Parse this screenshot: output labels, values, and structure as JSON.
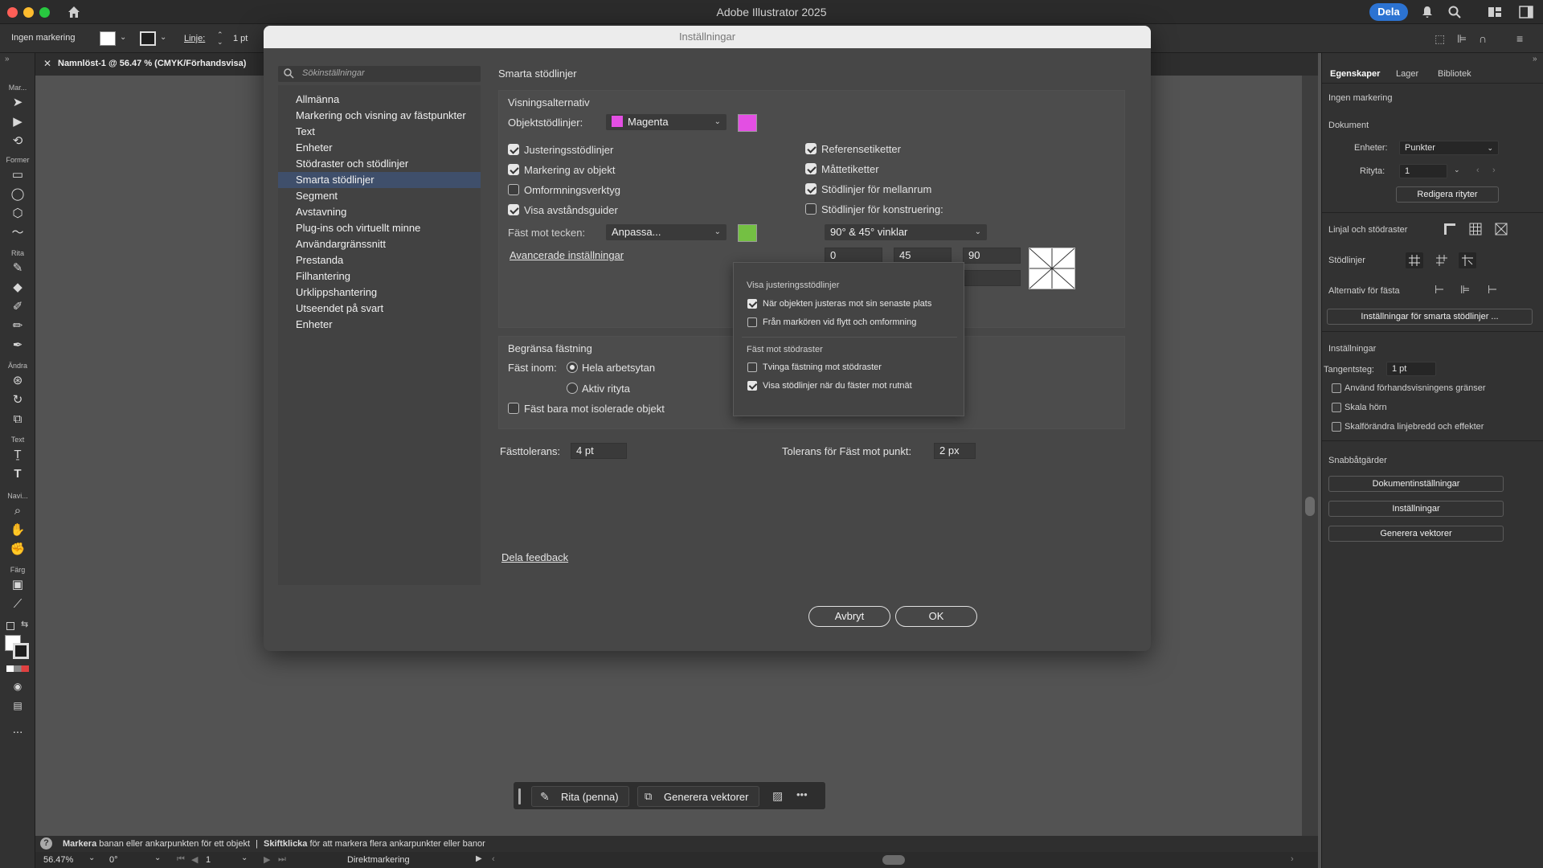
{
  "app": {
    "title": "Adobe Illustrator 2025",
    "share": "Dela",
    "accent": "#2c73d2"
  },
  "controlbar": {
    "selection": "Ingen markering",
    "stroke_label": "Linje:",
    "stroke_value": "1 pt"
  },
  "document_tab": {
    "name": "Namnlöst-1 @ 56.47 % (CMYK/Förhandsvisa)"
  },
  "tools": {
    "categories": [
      "Mar...",
      "Former",
      "Rita",
      "Ändra",
      "Text",
      "Navi...",
      "Färg"
    ],
    "more": "..."
  },
  "properties_panel": {
    "tabs": [
      "Egenskaper",
      "Lager",
      "Bibliotek"
    ],
    "no_selection": "Ingen markering",
    "document_label": "Dokument",
    "units_label": "Enheter:",
    "units_value": "Punkter",
    "artboard_label": "Rityta:",
    "artboard_value": "1",
    "edit_artboards": "Redigera rityter",
    "rulers_label": "Linjal och stödraster",
    "guides_label": "Stödlinjer",
    "snap_label": "Alternativ för fästa",
    "smart_guides_btn": "Inställningar för smarta stödlinjer ...",
    "preferences_label": "Inställningar",
    "keyboard_inc_label": "Tangentsteg:",
    "keyboard_inc_value": "1 pt",
    "pref_checks": [
      {
        "label": "Använd förhandsvisningens gränser",
        "checked": false
      },
      {
        "label": "Skala hörn",
        "checked": false
      },
      {
        "label": "Skalförändra linjebredd och effekter",
        "checked": false
      }
    ],
    "quick_actions_label": "Snabbåtgärder",
    "quick_actions": [
      "Dokumentinställningar",
      "Inställningar",
      "Generera vektorer"
    ]
  },
  "dialog": {
    "title": "Inställningar",
    "search_placeholder": "Sökinställningar",
    "nav": [
      "Allmänna",
      "Markering och visning av fästpunkter",
      "Text",
      "Enheter",
      "Stödraster och stödlinjer",
      "Smarta stödlinjer",
      "Segment",
      "Avstavning",
      "Plug-ins och virtuellt minne",
      "Användargränssnitt",
      "Prestanda",
      "Filhantering",
      "Urklippshantering",
      "Utseendet på svart",
      "Enheter"
    ],
    "selected_nav": "Smarta stödlinjer",
    "page_title": "Smarta stödlinjer",
    "display_options": {
      "title": "Visningsalternativ",
      "object_guides_label": "Objektstödlinjer:",
      "object_guides_value": "Magenta",
      "object_guides_color": "#e34fe3",
      "left_checks": [
        {
          "label": "Justeringsstödlinjer",
          "checked": true
        },
        {
          "label": "Markering av objekt",
          "checked": true
        },
        {
          "label": "Omformningsverktyg",
          "checked": false
        },
        {
          "label": "Visa avståndsguider",
          "checked": true
        }
      ],
      "right_checks": [
        {
          "label": "Referensetiketter",
          "checked": true
        },
        {
          "label": "Måttetiketter",
          "checked": true
        },
        {
          "label": "Stödlinjer för mellanrum",
          "checked": true
        },
        {
          "label": "Stödlinjer för konstruering:",
          "checked": false
        }
      ],
      "snap_to_glyph_label": "Fäst mot tecken:",
      "snap_to_glyph_value": "Anpassa...",
      "snap_to_glyph_color": "#74c043",
      "construction_angles": "90° & 45° vinklar",
      "angles": [
        "0",
        "45",
        "90"
      ],
      "advanced_link": "Avancerade inställningar"
    },
    "advanced_popup": {
      "section1": "Visa justeringsstödlinjer",
      "checks1": [
        {
          "label": "När objekten justeras mot sin senaste plats",
          "checked": true
        },
        {
          "label": "Från markören vid flytt och omformning",
          "checked": false
        }
      ],
      "section2": "Fäst mot stödraster",
      "checks2": [
        {
          "label": "Tvinga fästning mot stödraster",
          "checked": false
        },
        {
          "label": "Visa stödlinjer när du fäster mot rutnät",
          "checked": true
        }
      ]
    },
    "restrict_snapping": {
      "title": "Begränsa fästning",
      "snap_within_label": "Fäst inom:",
      "radios": [
        {
          "label": "Hela arbetsytan",
          "checked": true
        },
        {
          "label": "Aktiv rityta",
          "checked": false
        }
      ],
      "isolated_label": "Fäst bara mot isolerade objekt",
      "isolated_checked": false
    },
    "snap_tolerance_label": "Fästtolerans:",
    "snap_tolerance_value": "4 pt",
    "point_tolerance_label": "Tolerans för Fäst mot punkt:",
    "point_tolerance_value": "2 px",
    "feedback_link": "Dela feedback",
    "cancel": "Avbryt",
    "ok": "OK"
  },
  "floating_bar": {
    "draw": "Rita (penna)",
    "generate": "Generera vektorer",
    "more": "•••"
  },
  "status": {
    "hint_bold1": "Markera",
    "hint_text1": "banan eller ankarpunkten för ett objekt",
    "separator": "|",
    "hint_bold2": "Skiftklicka",
    "hint_text2": "för att markera flera ankarpunkter eller banor",
    "zoom": "56.47%",
    "rotation": "0°",
    "artboard": "1",
    "tool": "Direktmarkering"
  }
}
